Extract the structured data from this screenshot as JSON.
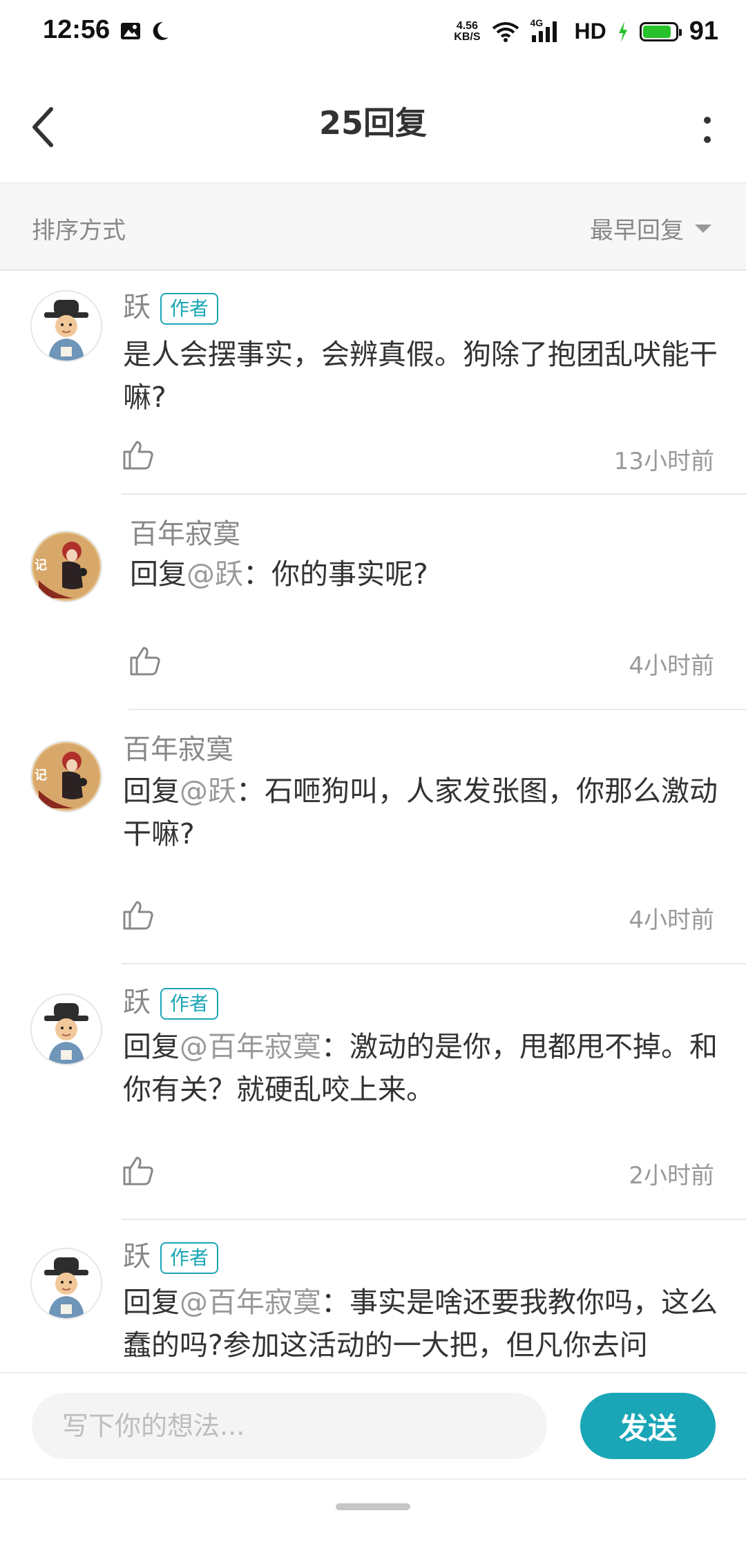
{
  "status": {
    "time": "12:56",
    "speed_top": "4.56",
    "speed_unit": "KB/S",
    "net_type": "4G",
    "hd": "HD",
    "battery_level": "91",
    "battery_fraction": 0.91
  },
  "header": {
    "title": "25回复"
  },
  "sort": {
    "label": "排序方式",
    "selected": "最早回复"
  },
  "comments": [
    {
      "username": "跃",
      "badge": "作者",
      "text": "是人会摆事实，会辨真假。狗除了抱团乱吠能干嘛?",
      "time": "13小时前",
      "avatar": "author-avatar"
    },
    {
      "username": "百年寂寞",
      "badge": "",
      "reply_prefix": "回复",
      "reply_to": "@跃",
      "reply_text": "：你的事实呢?",
      "time": "4小时前",
      "avatar": "girl-avatar"
    },
    {
      "username": "百年寂寞",
      "badge": "",
      "reply_prefix": "回复",
      "reply_to": "@跃",
      "reply_text": "：石咂狗叫，人家发张图，你那么激动干嘛?",
      "time": "4小时前",
      "avatar": "girl-avatar"
    },
    {
      "username": "跃",
      "badge": "作者",
      "reply_prefix": "回复",
      "reply_to": "@百年寂寞",
      "reply_text": "：激动的是你，甩都甩不掉。和你有关？就硬乱咬上来。",
      "time": "2小时前",
      "avatar": "author-avatar"
    },
    {
      "username": "跃",
      "badge": "作者",
      "reply_prefix": "回复",
      "reply_to": "@百年寂寞",
      "reply_text": "：事实是啥还要我教你吗，这么蠢的吗?参加这活动的一大把，但凡你去问",
      "time": "",
      "avatar": "author-avatar"
    }
  ],
  "composer": {
    "placeholder": "写下你的想法...",
    "send_label": "发送"
  },
  "colors": {
    "accent": "#1aa6b7",
    "battery": "#27c22b"
  }
}
